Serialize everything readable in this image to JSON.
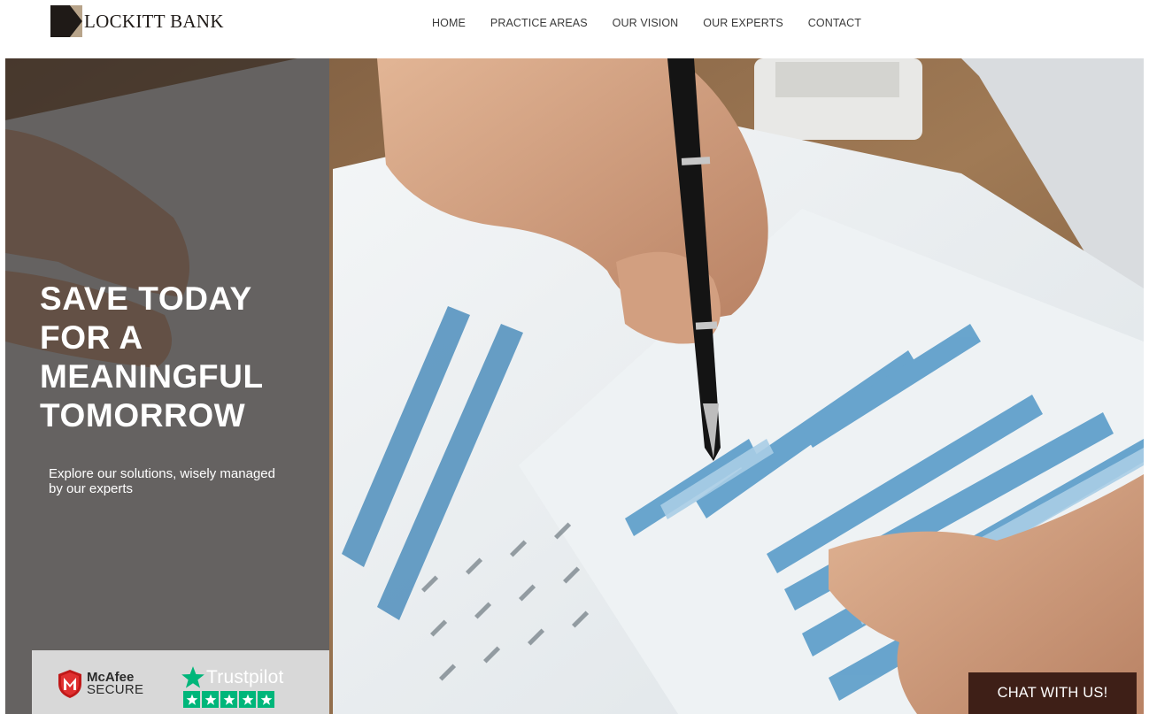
{
  "brand": {
    "name": "LOCKITT BANK"
  },
  "nav": {
    "items": [
      {
        "label": "HOME"
      },
      {
        "label": "PRACTICE AREAS"
      },
      {
        "label": "OUR VISION"
      },
      {
        "label": "OUR EXPERTS"
      },
      {
        "label": "CONTACT"
      }
    ]
  },
  "hero": {
    "headline_lines": [
      "SAVE TODAY",
      "FOR A",
      "MEANINGFUL",
      "TOMORROW"
    ],
    "subtitle": "Explore our solutions, wisely managed by our experts",
    "image_description_icon": "financial-documents-photo"
  },
  "badges": {
    "mcafee_name": "McAfee",
    "mcafee_sub": "SECURE",
    "trustpilot_name": "Trustpilot",
    "trustpilot_rating": 5
  },
  "chat": {
    "label": "CHAT WITH US!"
  },
  "colors": {
    "overlay": "#2d2824",
    "chat_button": "#3e1f17",
    "trustpilot_green": "#00b67a",
    "mcafee_red": "#c01818",
    "logo_tan": "#b8a48a",
    "logo_dark": "#1f1a17"
  }
}
